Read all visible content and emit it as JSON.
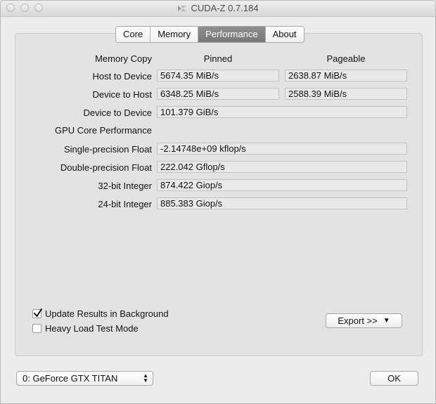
{
  "window": {
    "title": "CUDA-Z 0.7.184"
  },
  "tabs": [
    {
      "label": "Core"
    },
    {
      "label": "Memory"
    },
    {
      "label": "Performance"
    },
    {
      "label": "About"
    }
  ],
  "memory_copy": {
    "heading": "Memory Copy",
    "col_pinned": "Pinned",
    "col_pageable": "Pageable",
    "rows": [
      {
        "label": "Host to Device",
        "pinned": "5674.35 MiB/s",
        "pageable": "2638.87 MiB/s"
      },
      {
        "label": "Device to Host",
        "pinned": "6348.25 MiB/s",
        "pageable": "2588.39 MiB/s"
      },
      {
        "label": "Device to Device",
        "value": "101.379 GiB/s"
      }
    ]
  },
  "gpu_core": {
    "heading": "GPU Core Performance",
    "rows": [
      {
        "label": "Single-precision Float",
        "value": "-2.14748e+09 kflop/s"
      },
      {
        "label": "Double-precision Float",
        "value": "222.042 Gflop/s"
      },
      {
        "label": "32-bit Integer",
        "value": "874.422 Giop/s"
      },
      {
        "label": "24-bit Integer",
        "value": "885.383 Giop/s"
      }
    ]
  },
  "options": {
    "update_background": {
      "label": "Update Results in Background",
      "checked": true
    },
    "heavy_load": {
      "label": "Heavy Load Test Mode",
      "checked": false
    }
  },
  "export_button": {
    "label": "Export >>"
  },
  "device_select": {
    "value": "0: GeForce GTX TITAN"
  },
  "ok_button": {
    "label": "OK"
  },
  "colors": {
    "active_tab": "#808080",
    "panel": "#e3e3e3",
    "field": "#e9e9e9"
  }
}
